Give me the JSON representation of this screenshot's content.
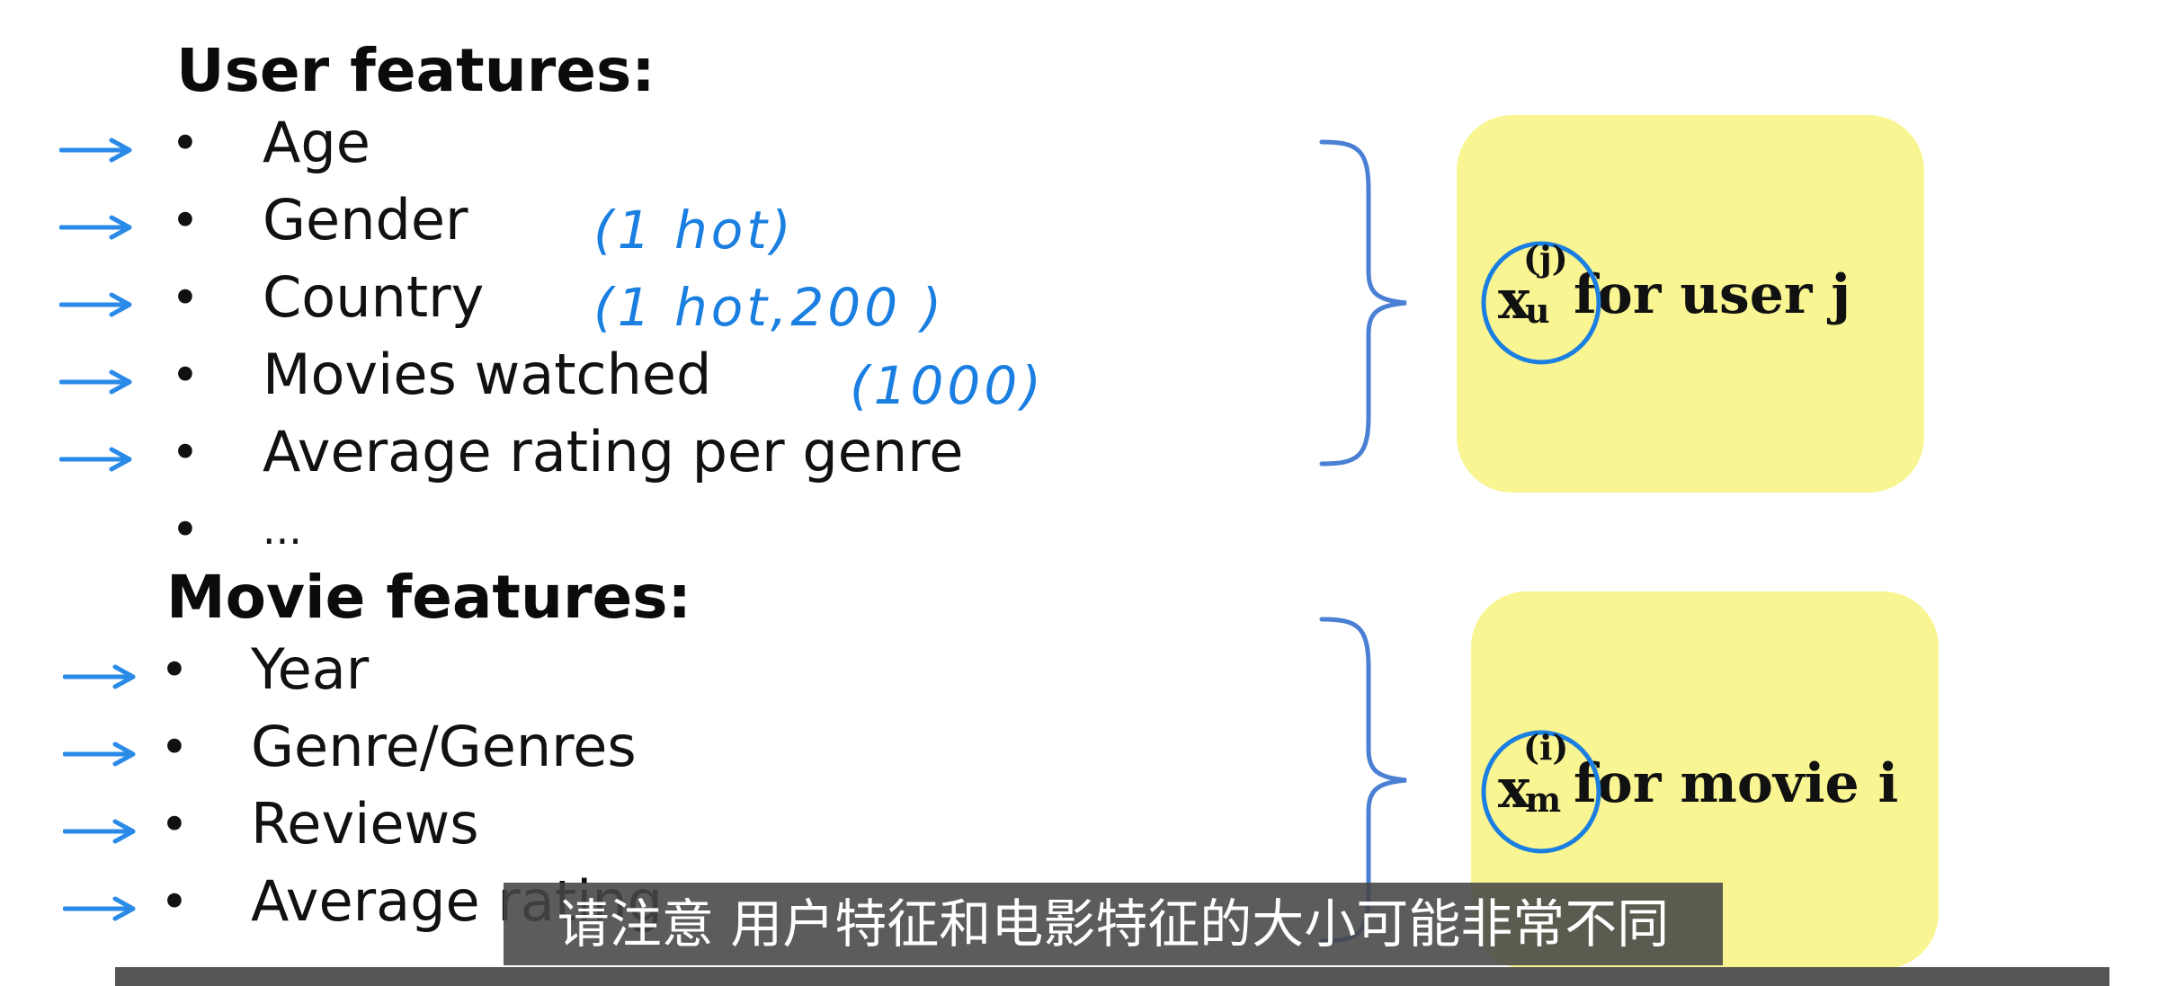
{
  "user_section": {
    "heading": "User features:",
    "items": [
      {
        "label": "Age"
      },
      {
        "label": "Gender"
      },
      {
        "label": "Country"
      },
      {
        "label": "Movies watched"
      },
      {
        "label": "Average rating per genre"
      },
      {
        "label": "..."
      }
    ]
  },
  "movie_section": {
    "heading": "Movie features:",
    "items": [
      {
        "label": "Year"
      },
      {
        "label": "Genre/Genres"
      },
      {
        "label": "Reviews"
      },
      {
        "label": "Average rating"
      }
    ]
  },
  "annotations": {
    "gender": "(1 hot)",
    "country": "(1 hot,200 )",
    "movies_watched": "(1000)"
  },
  "user_vector": {
    "symbol": "x",
    "superscript": "(j)",
    "subscript": "u",
    "text": "for user j"
  },
  "movie_vector": {
    "symbol": "x",
    "superscript": "(i)",
    "subscript": "m",
    "text": "for movie i"
  },
  "subtitle": "请注意 用户特征和电影特征的大小可能非常不同",
  "colors": {
    "annotation_blue": "#1a7fe0",
    "box_yellow": "#f9f592",
    "brace_blue": "#4a7fd4"
  }
}
